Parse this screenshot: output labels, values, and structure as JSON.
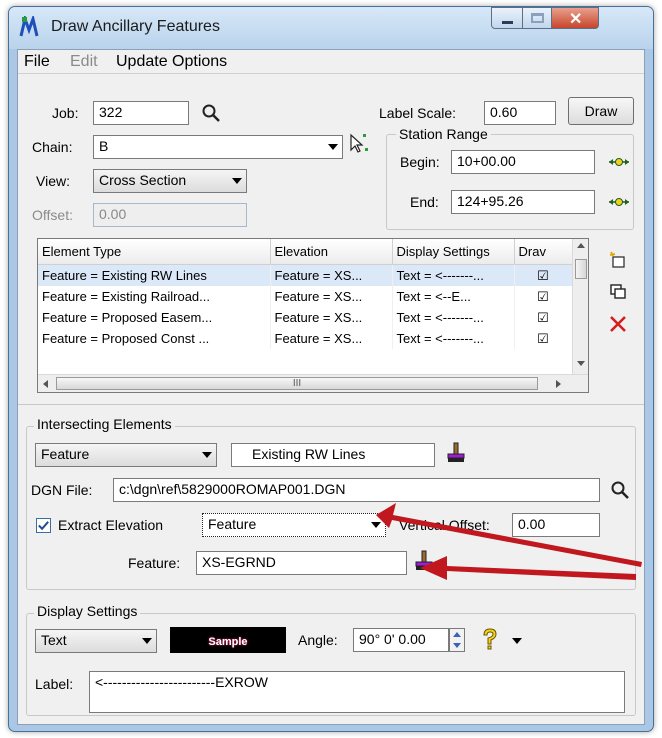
{
  "window": {
    "title": "Draw Ancillary Features"
  },
  "menu": {
    "file": "File",
    "edit": "Edit",
    "update_options": "Update Options"
  },
  "job": {
    "label": "Job:",
    "value": "322"
  },
  "label_scale": {
    "label": "Label Scale:",
    "value": "0.60"
  },
  "draw_button": "Draw",
  "chain": {
    "label": "Chain:",
    "value": "B"
  },
  "view": {
    "label": "View:",
    "value": "Cross Section"
  },
  "offset": {
    "label": "Offset:",
    "value": "0.00"
  },
  "station_range": {
    "title": "Station Range",
    "begin_label": "Begin:",
    "begin_value": "10+00.00",
    "end_label": "End:",
    "end_value": "124+95.26"
  },
  "element_table": {
    "headers": [
      "Element Type",
      "Elevation",
      "Display Settings",
      "Drav"
    ],
    "rows": [
      {
        "element_type": "Feature = Existing RW Lines",
        "elevation": "Feature = XS...",
        "display": "Text = <-------...",
        "draw": "☑"
      },
      {
        "element_type": "Feature = Existing Railroad...",
        "elevation": "Feature = XS...",
        "display": "Text = <--E...",
        "draw": "☑"
      },
      {
        "element_type": "Feature = Proposed Easem...",
        "elevation": "Feature = XS...",
        "display": "Text = <-------...",
        "draw": "☑"
      },
      {
        "element_type": "Feature = Proposed Const ...",
        "elevation": "Feature = XS...",
        "display": "Text = <-------...",
        "draw": "☑"
      }
    ],
    "hscroll_thumb": "III"
  },
  "intersecting": {
    "title": "Intersecting Elements",
    "type_value": "Feature",
    "feature_value": "Existing RW Lines",
    "dgn_label": "DGN File:",
    "dgn_value": "c:\\dgn\\ref\\5829000ROMAP001.DGN",
    "extract_label": "Extract Elevation",
    "extract_checked": true,
    "extract_type": "Feature",
    "vertical_offset_label": "Vertical Offset:",
    "vertical_offset_value": "0.00",
    "feature_label": "Feature:",
    "feature_field_value": "XS-EGRND"
  },
  "display_settings": {
    "title": "Display Settings",
    "type_value": "Text",
    "sample_text": "Sample",
    "angle_label": "Angle:",
    "angle_value": "90° 0' 0.00",
    "label_label": "Label:",
    "label_value": "<------------------------EXROW"
  },
  "colors": {
    "annotation_arrow": "#c0181e",
    "title_bar": "#c7dcf1",
    "selection": "#dbe8f7"
  },
  "icons": [
    "app-icon",
    "search-icon",
    "select-element-icon",
    "station-pick-icon",
    "new-icon",
    "copy-icon",
    "delete-icon",
    "feature-pick-icon",
    "help-icon"
  ]
}
